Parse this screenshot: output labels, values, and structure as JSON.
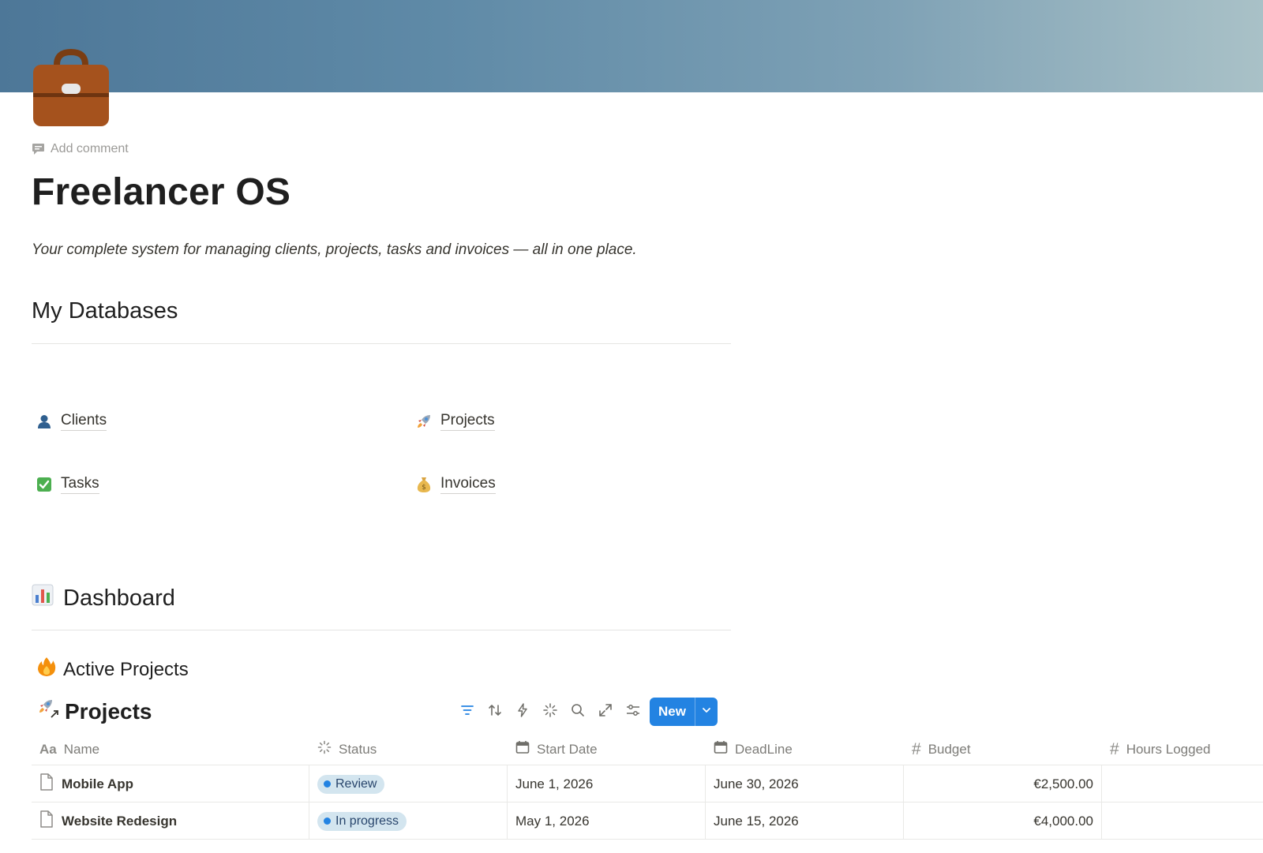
{
  "page": {
    "add_comment": "Add comment",
    "title": "Freelancer OS",
    "subtitle": "Your complete system for managing clients, projects, tasks and invoices — all in one place.",
    "page_icon": "briefcase-icon"
  },
  "databases": {
    "heading": "My Databases",
    "links": [
      {
        "label": "Clients",
        "icon": "person-icon"
      },
      {
        "label": "Projects",
        "icon": "rocket-icon"
      },
      {
        "label": "Tasks",
        "icon": "checkbox-icon"
      },
      {
        "label": "Invoices",
        "icon": "money-bag-icon"
      }
    ]
  },
  "dashboard": {
    "heading": "Dashboard",
    "section": "Active Projects",
    "db_title": "Projects",
    "new_label": "New",
    "columns": [
      {
        "label": "Name",
        "icon": "text-icon"
      },
      {
        "label": "Status",
        "icon": "status-icon"
      },
      {
        "label": "Start Date",
        "icon": "calendar-icon"
      },
      {
        "label": "DeadLine",
        "icon": "calendar-icon"
      },
      {
        "label": "Budget",
        "icon": "number-icon"
      },
      {
        "label": "Hours Logged",
        "icon": "number-icon"
      }
    ],
    "rows": [
      {
        "name": "Mobile App",
        "status": "Review",
        "start": "June 1, 2026",
        "deadline": "June 30, 2026",
        "budget": "€2,500.00",
        "hours": ""
      },
      {
        "name": "Website Redesign",
        "status": "In progress",
        "start": "May 1, 2026",
        "deadline": "June 15, 2026",
        "budget": "€4,000.00",
        "hours": ""
      }
    ]
  },
  "colors": {
    "accent": "#2383e2",
    "status_pill_bg": "#d3e5ef",
    "status_pill_text": "#28456c",
    "status_dot": "#2383e2"
  }
}
